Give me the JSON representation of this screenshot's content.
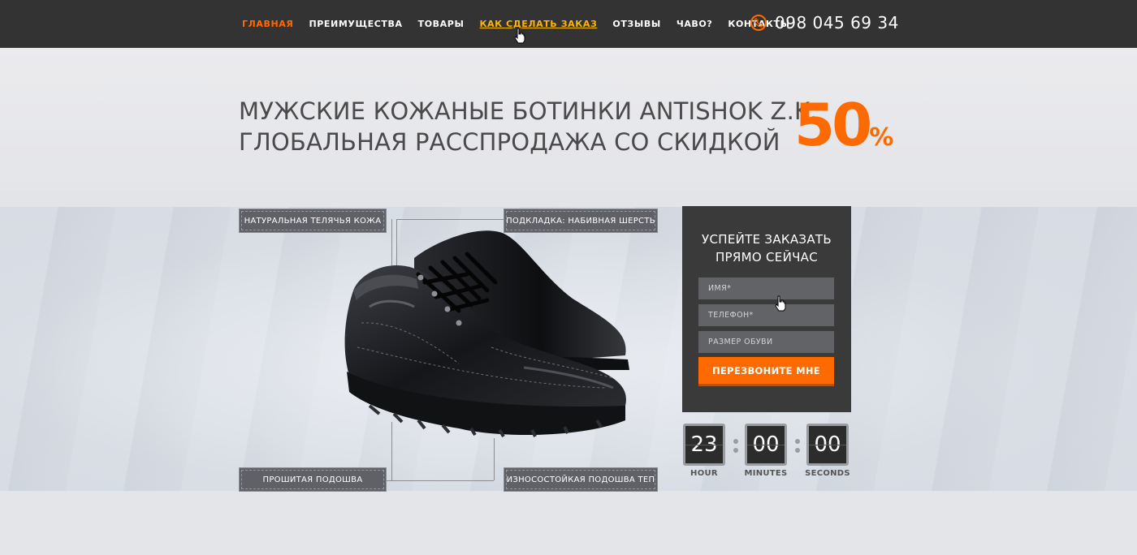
{
  "nav": {
    "items": [
      {
        "label": "ГЛАВНАЯ",
        "state": "active"
      },
      {
        "label": "ПРЕИМУЩЕСТВА",
        "state": "normal"
      },
      {
        "label": "ТОВАРЫ",
        "state": "normal"
      },
      {
        "label": "КАК СДЕЛАТЬ ЗАКАЗ",
        "state": "hover"
      },
      {
        "label": "ОТЗЫВЫ",
        "state": "normal"
      },
      {
        "label": "ЧАВО?",
        "state": "normal"
      },
      {
        "label": "КОНТАКТЫ",
        "state": "normal"
      }
    ],
    "phone": "098 045 69 34",
    "phone_icon": "phone-icon"
  },
  "hero": {
    "line1": "МУЖСКИЕ КОЖАНЫЕ БОТИНКИ ANTISHOK Z.K.",
    "line2": "ГЛОБАЛЬНАЯ РАССПРОДАЖА СО СКИДКОЙ",
    "discount_number": "50",
    "discount_symbol": "%"
  },
  "features": {
    "top_left": "НАТУРАЛЬНАЯ ТЕЛЯЧЬЯ КОЖА",
    "top_right": "ПОДКЛАДКА: НАБИВНАЯ ШЕРСТЬ",
    "bottom_left": "ПРОШИТАЯ ПОДОШВА",
    "bottom_right": "ИЗНОСОСТОЙКАЯ ПОДОШВА ТЕП"
  },
  "form": {
    "title_line1": "УСПЕЙТЕ ЗАКАЗАТЬ",
    "title_line2": "ПРЯМО СЕЙЧАС",
    "name_placeholder": "ИМЯ*",
    "phone_placeholder": "ТЕЛЕФОН*",
    "size_placeholder": "РАЗМЕР ОБУВИ",
    "submit_label": "ПЕРЕЗВОНИТЕ МНЕ"
  },
  "countdown": {
    "hours": "23",
    "minutes": "00",
    "seconds": "00",
    "hours_label": "HOUR",
    "minutes_label": "MINUTES",
    "seconds_label": "SECONDS"
  },
  "colors": {
    "accent": "#ff6a00",
    "nav_bg": "#333333",
    "hover": "#ffb400",
    "form_bg": "#3a3a3a"
  }
}
